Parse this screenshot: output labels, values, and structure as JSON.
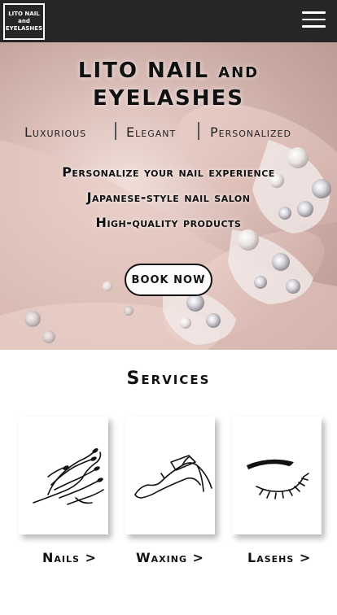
{
  "header": {
    "logo_lines": [
      "LITO NAIL",
      "and",
      "EYELASHES"
    ],
    "menu_icon": "hamburger-menu-icon"
  },
  "hero": {
    "title_line1": "LITO NAIL and",
    "title_line2": "EYELASHES",
    "taglines": [
      "Luxurious",
      "Elegant",
      "Personalized"
    ],
    "features": [
      "Personalize your nail experience",
      "Japanese-style nail salon",
      "High-quality products"
    ],
    "book_button": "BOOK NOW"
  },
  "services": {
    "title": "Services",
    "items": [
      {
        "label": "Nails >",
        "icon": "manicure-hand-icon"
      },
      {
        "label": "Waxing >",
        "icon": "leg-waxing-icon"
      },
      {
        "label": "Lasehs >",
        "icon": "eyelash-icon"
      }
    ]
  },
  "colors": {
    "header_bg": "#262626",
    "text": "#111111",
    "hero_tint": "#ddc0ba"
  }
}
